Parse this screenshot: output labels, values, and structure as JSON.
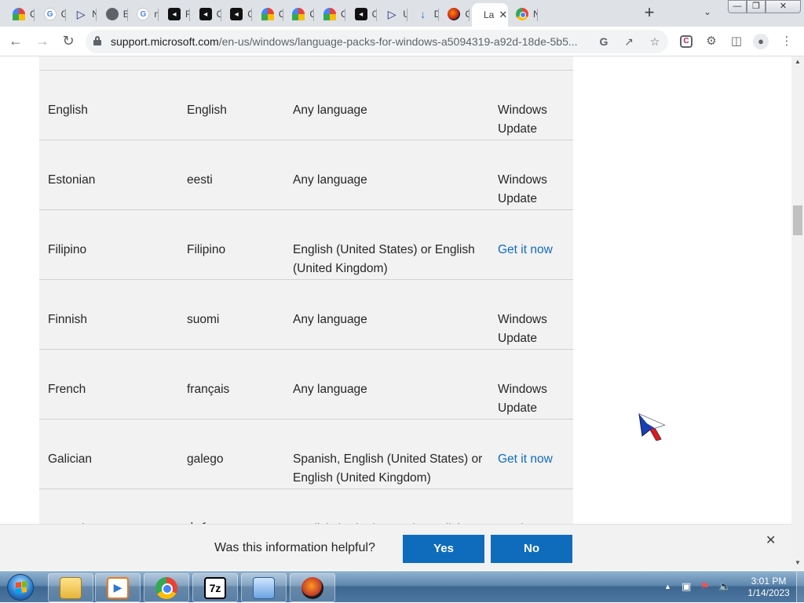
{
  "browser": {
    "tabs": [
      {
        "favicon": "rainbow-icon",
        "title": "C"
      },
      {
        "favicon": "google-icon",
        "title": "G"
      },
      {
        "favicon": "play-icon",
        "title": "N"
      },
      {
        "favicon": "globe-icon",
        "title": "E"
      },
      {
        "favicon": "google-icon",
        "title": "n"
      },
      {
        "favicon": "black-square-icon",
        "title": "R"
      },
      {
        "favicon": "black-square-icon",
        "title": "C"
      },
      {
        "favicon": "black-square-icon",
        "title": "C"
      },
      {
        "favicon": "rainbow-icon",
        "title": "C"
      },
      {
        "favicon": "rainbow-icon",
        "title": "C"
      },
      {
        "favicon": "rainbow-icon",
        "title": "C"
      },
      {
        "favicon": "black-square-icon",
        "title": "C"
      },
      {
        "favicon": "play-icon",
        "title": "U"
      },
      {
        "favicon": "download-icon",
        "title": "D"
      },
      {
        "favicon": "fire-icon",
        "title": "C"
      },
      {
        "favicon": "none",
        "title": "La",
        "active": true
      },
      {
        "favicon": "chrome-icon",
        "title": "N"
      }
    ],
    "url_host": "support.microsoft.com",
    "url_path": "/en-us/windows/language-packs-for-windows-a5094319-a92d-18de-5b5..."
  },
  "language_table": {
    "rows": [
      {
        "language": "English",
        "native": "English",
        "base": "Any language",
        "availability": "Windows Update",
        "is_link": false
      },
      {
        "language": "Estonian",
        "native": "eesti",
        "base": "Any language",
        "availability": "Windows Update",
        "is_link": false
      },
      {
        "language": "Filipino",
        "native": "Filipino",
        "base": "English (United States) or English (United Kingdom)",
        "availability": "Get it now",
        "is_link": true
      },
      {
        "language": "Finnish",
        "native": "suomi",
        "base": "Any language",
        "availability": "Windows Update",
        "is_link": false
      },
      {
        "language": "French",
        "native": "français",
        "base": "Any language",
        "availability": "Windows Update",
        "is_link": false
      },
      {
        "language": "Galician",
        "native": "galego",
        "base": "Spanish, English (United States) or English (United Kingdom)",
        "availability": "Get it now",
        "is_link": true
      },
      {
        "language": "Georgian",
        "native": "ქართული",
        "base": "English (United States), English",
        "availability": "Get it now",
        "is_link": true
      }
    ]
  },
  "feedback": {
    "question": "Was this information helpful?",
    "yes_label": "Yes",
    "no_label": "No"
  },
  "taskbar": {
    "apps": [
      "folder-icon",
      "media-player-icon",
      "chrome-icon",
      "7zip-icon",
      "remote-desktop-icon",
      "firefox-icon"
    ],
    "time": "3:01 PM",
    "date": "1/14/2023"
  },
  "colors": {
    "link": "#0f6cbd",
    "button": "#0f6cbd",
    "table_bg": "#f2f2f2"
  }
}
